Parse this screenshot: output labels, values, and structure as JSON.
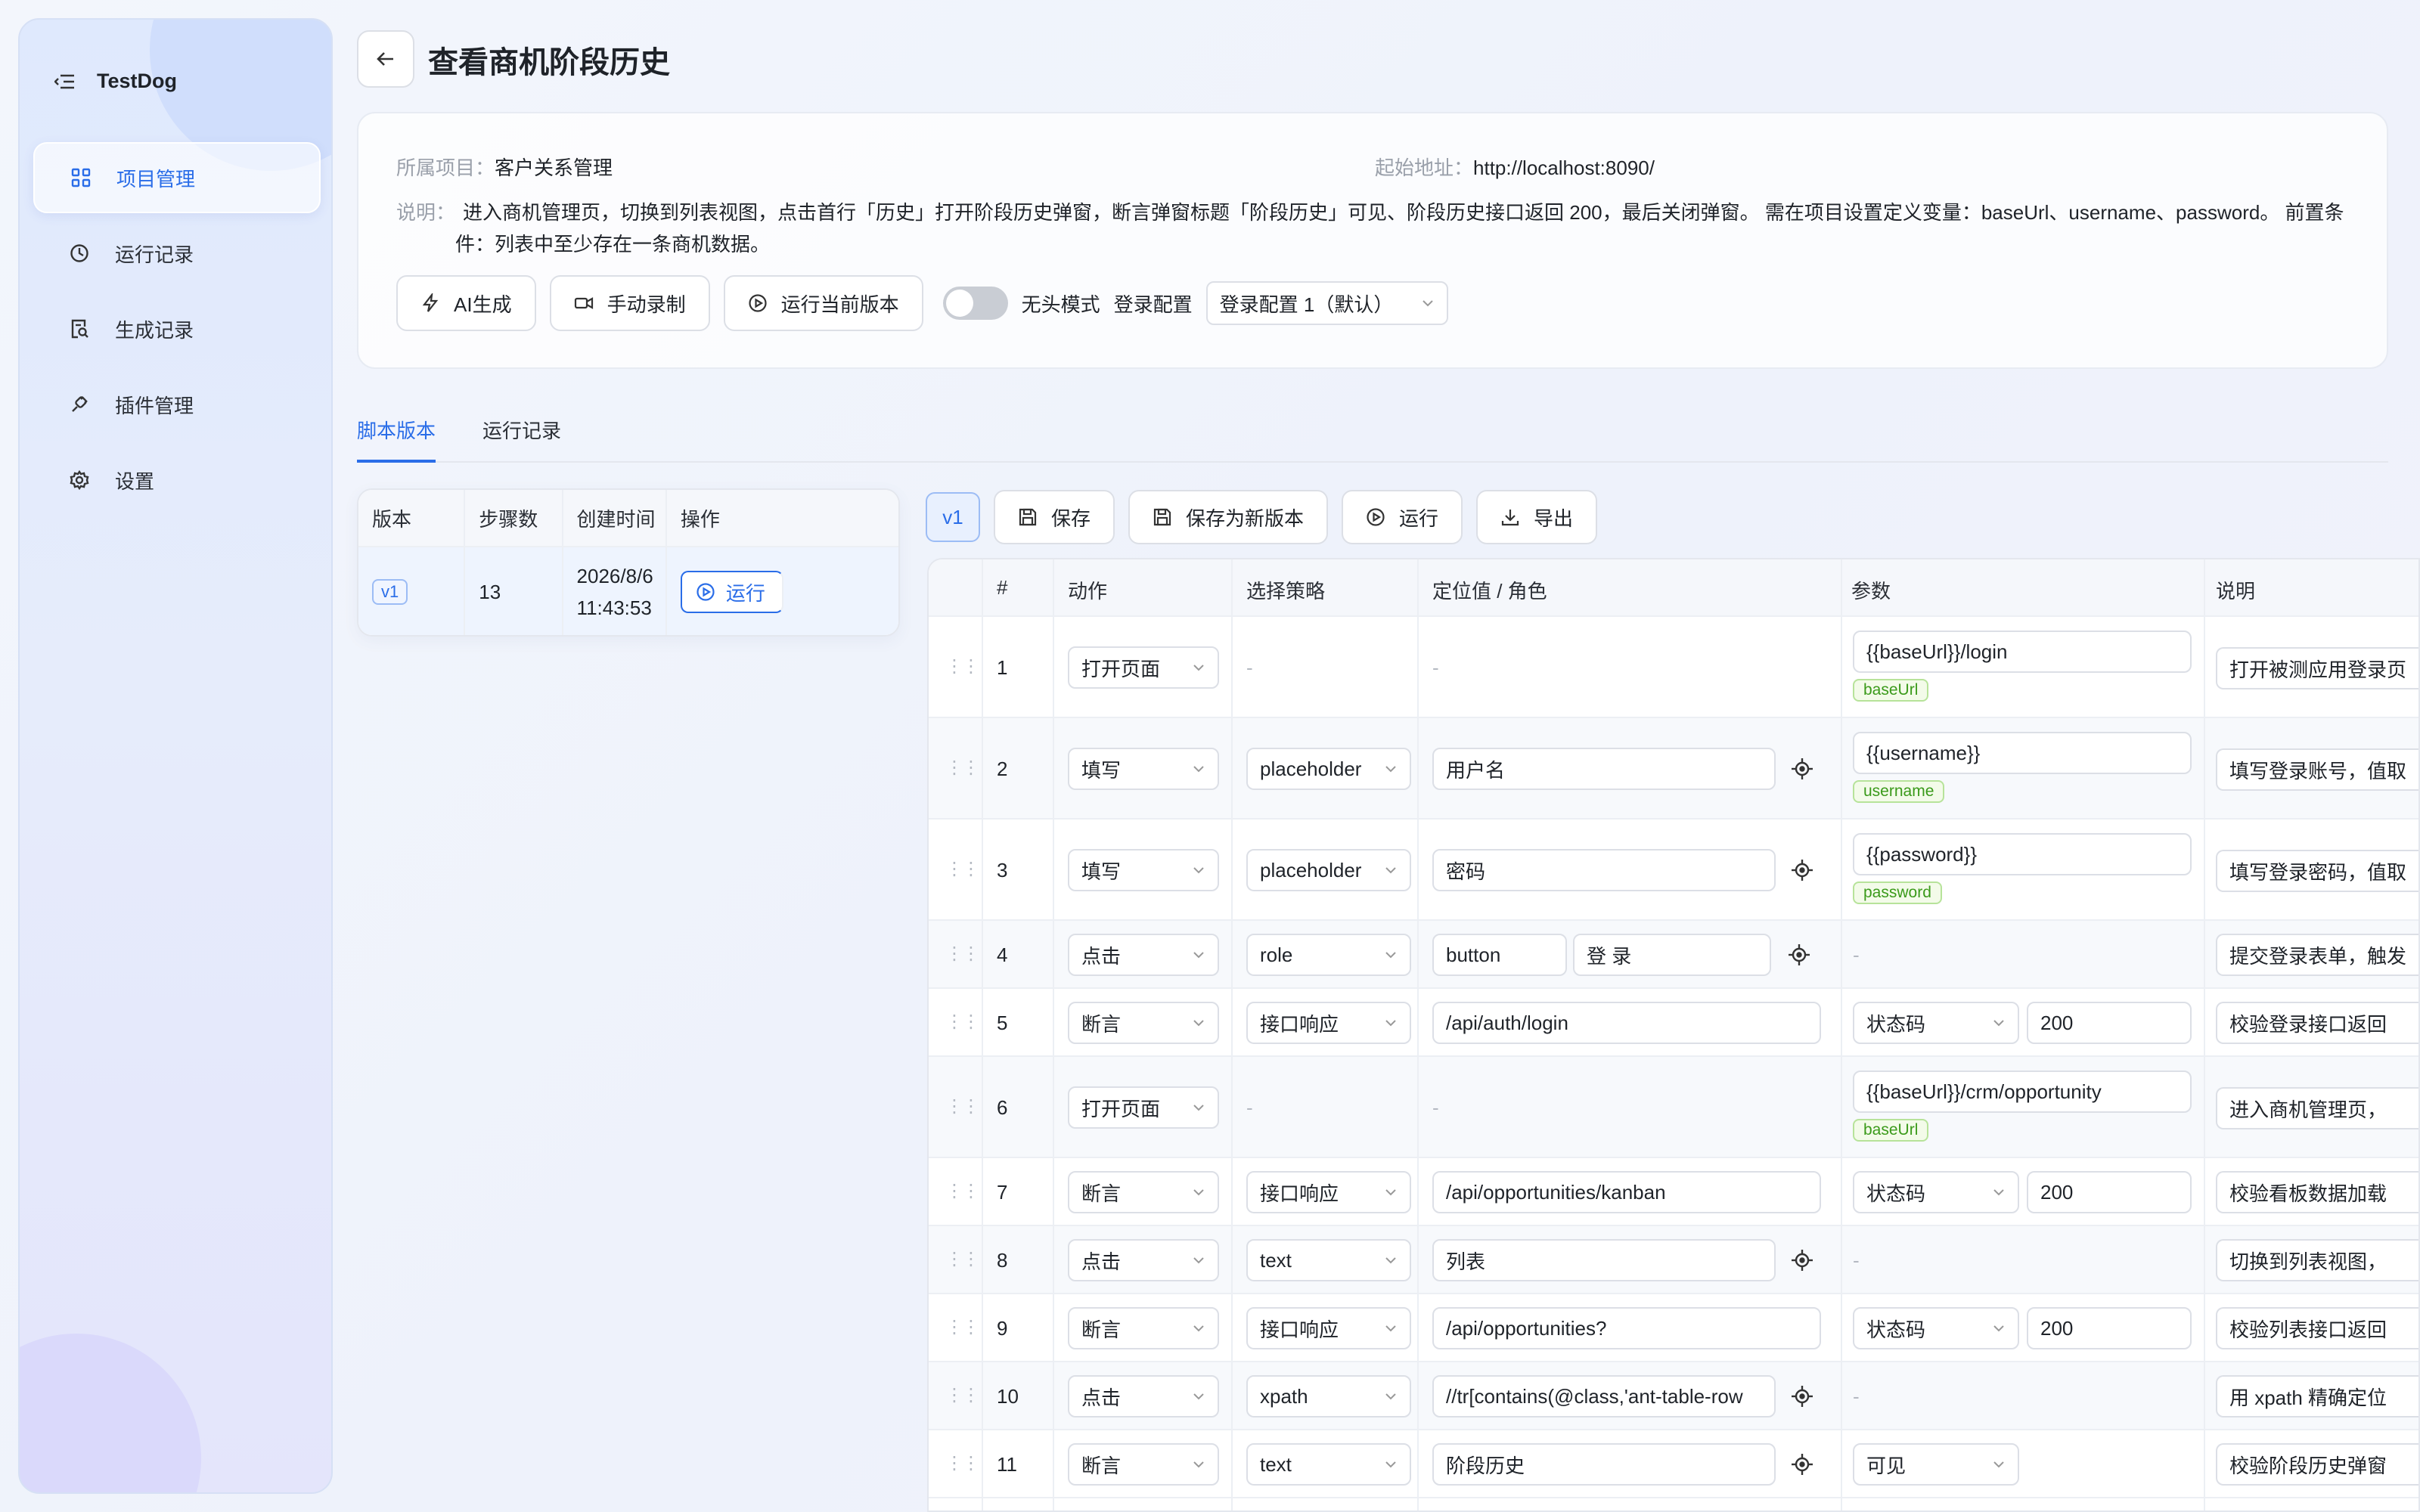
{
  "app": {
    "name": "TestDog"
  },
  "sidebar": {
    "items": [
      {
        "label": "项目管理",
        "icon": "grid-icon",
        "active": true
      },
      {
        "label": "运行记录",
        "icon": "clock-icon",
        "active": false
      },
      {
        "label": "生成记录",
        "icon": "document-search-icon",
        "active": false
      },
      {
        "label": "插件管理",
        "icon": "plug-icon",
        "active": false
      },
      {
        "label": "设置",
        "icon": "gear-icon",
        "active": false
      }
    ]
  },
  "header": {
    "title": "查看商机阶段历史"
  },
  "info": {
    "project_label": "所属项目：",
    "project_value": "客户关系管理",
    "url_label": "起始地址：",
    "url_value": "http://localhost:8090/",
    "desc_label": "说明：",
    "desc_value": "进入商机管理页，切换到列表视图，点击首行「历史」打开阶段历史弹窗，断言弹窗标题「阶段历史」可见、阶段历史接口返回 200，最后关闭弹窗。 需在项目设置定义变量：baseUrl、username、password。 前置条件：列表中至少存在一条商机数据。"
  },
  "actions": {
    "ai_generate": "AI生成",
    "manual_record": "手动录制",
    "run_current": "运行当前版本",
    "headless_label": "无头模式",
    "login_config_label": "登录配置",
    "login_config_value": "登录配置 1（默认）"
  },
  "tabs": [
    {
      "label": "脚本版本",
      "active": true
    },
    {
      "label": "运行记录",
      "active": false
    }
  ],
  "versions": {
    "headers": [
      "版本",
      "步骤数",
      "创建时间",
      "操作"
    ],
    "rows": [
      {
        "version": "v1",
        "steps": "13",
        "date": "2026/8/6",
        "time": "11:43:53",
        "action": "运行"
      }
    ]
  },
  "toolbar": {
    "version": "v1",
    "save": "保存",
    "save_new": "保存为新版本",
    "run": "运行",
    "export": "导出"
  },
  "steps": {
    "headers": [
      "#",
      "动作",
      "选择策略",
      "定位值 / 角色",
      "参数",
      "说明"
    ],
    "rows": [
      {
        "n": "1",
        "action": "打开页面",
        "strategy": "",
        "locator": "",
        "param": "{{baseUrl}}/login",
        "tag": "baseUrl",
        "note": "打开被测应用登录页"
      },
      {
        "n": "2",
        "action": "填写",
        "strategy": "placeholder",
        "locator": "用户名",
        "param": "{{username}}",
        "tag": "username",
        "note": "填写登录账号，值取"
      },
      {
        "n": "3",
        "action": "填写",
        "strategy": "placeholder",
        "locator": "密码",
        "param": "{{password}}",
        "tag": "password",
        "note": "填写登录密码，值取"
      },
      {
        "n": "4",
        "action": "点击",
        "strategy": "role",
        "locator": "button",
        "locator2": "登 录",
        "param": "",
        "note": "提交登录表单，触发"
      },
      {
        "n": "5",
        "action": "断言",
        "strategy": "接口响应",
        "locator": "/api/auth/login",
        "param_sel": "状态码",
        "param": "200",
        "note": "校验登录接口返回"
      },
      {
        "n": "6",
        "action": "打开页面",
        "strategy": "",
        "locator": "",
        "param": "{{baseUrl}}/crm/opportunity",
        "tag": "baseUrl",
        "note": "进入商机管理页，"
      },
      {
        "n": "7",
        "action": "断言",
        "strategy": "接口响应",
        "locator": "/api/opportunities/kanban",
        "param_sel": "状态码",
        "param": "200",
        "note": "校验看板数据加载"
      },
      {
        "n": "8",
        "action": "点击",
        "strategy": "text",
        "locator": "列表",
        "param": "",
        "note": "切换到列表视图，"
      },
      {
        "n": "9",
        "action": "断言",
        "strategy": "接口响应",
        "locator": "/api/opportunities?",
        "param_sel": "状态码",
        "param": "200",
        "note": "校验列表接口返回"
      },
      {
        "n": "10",
        "action": "点击",
        "strategy": "xpath",
        "locator": "//tr[contains(@class,'ant-table-row",
        "param": "",
        "note": "用 xpath 精确定位"
      },
      {
        "n": "11",
        "action": "断言",
        "strategy": "text",
        "locator": "阶段历史",
        "param_sel": "可见",
        "param": "",
        "note": "校验阶段历史弹窗"
      }
    ]
  },
  "colors": {
    "accent": "#2a6de8",
    "tag_green": "#3a9a1a"
  }
}
